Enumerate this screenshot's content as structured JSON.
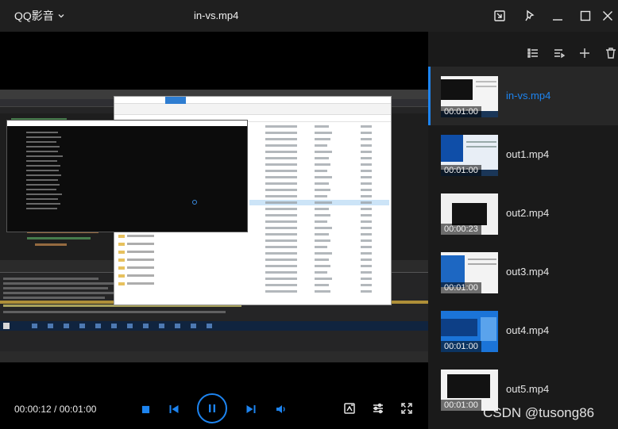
{
  "app": {
    "name": "QQ影音",
    "file_title": "in-vs.mp4"
  },
  "player": {
    "current_time": "00:00:12",
    "total_time": "00:01:00",
    "time_display": "00:00:12 / 00:01:00",
    "progress": 0.2
  },
  "playlist": [
    {
      "name": "in-vs.mp4",
      "duration": "00:01:00",
      "active": true
    },
    {
      "name": "out1.mp4",
      "duration": "00:01:00",
      "active": false
    },
    {
      "name": "out2.mp4",
      "duration": "00:00:23",
      "active": false
    },
    {
      "name": "out3.mp4",
      "duration": "00:01:00",
      "active": false
    },
    {
      "name": "out4.mp4",
      "duration": "00:01:00",
      "active": false
    },
    {
      "name": "out5.mp4",
      "duration": "00:01:00",
      "active": false
    }
  ],
  "watermark": "CSDN @tusong86",
  "colors": {
    "accent": "#1d84f0",
    "panel_bg": "#1a1a1a",
    "titlebar_bg": "#1f1f1f"
  }
}
